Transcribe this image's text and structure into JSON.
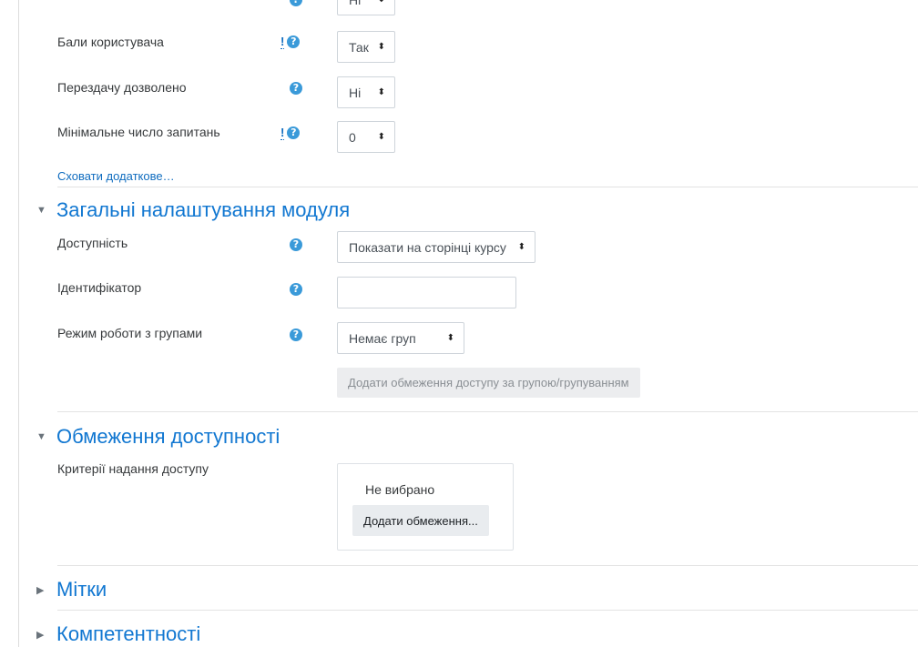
{
  "rows": [
    {
      "label": "",
      "select": "Ні"
    },
    {
      "label": "Бали користувача",
      "select": "Так"
    },
    {
      "label": "Перездачу дозволено",
      "select": "Ні"
    },
    {
      "label": "Мінімальне число запитань",
      "select": "0"
    }
  ],
  "icons": {
    "exclamation": "!",
    "help": "?"
  },
  "show_less_link": "Сховати додаткове…",
  "module_settings": {
    "title": "Загальні налаштування модуля",
    "availability_label": "Доступність",
    "availability_value": "Показати на сторінці курсу",
    "idnumber_label": "Ідентифікатор",
    "idnumber_value": "",
    "groupmode_label": "Режим роботи з групами",
    "groupmode_value": "Немає груп",
    "restrict_group_button": "Додати обмеження доступу за групою/групуванням"
  },
  "restrictions": {
    "title": "Обмеження доступності",
    "criteria_label": "Критерії надання доступу",
    "none_selected": "Не вибрано",
    "add_button": "Додати обмеження..."
  },
  "tags": {
    "title": "Мітки"
  },
  "competencies": {
    "title": "Компетентності"
  },
  "colors": {
    "link": "#0f6cbf",
    "heading": "#1177d1",
    "help_icon": "#3a9ad9"
  }
}
